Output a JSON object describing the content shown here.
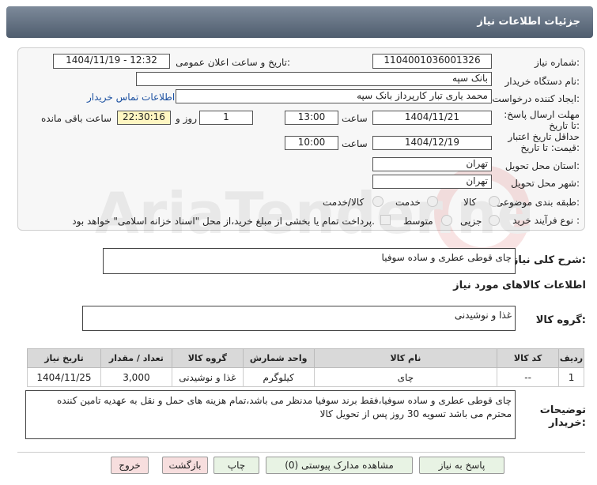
{
  "page_title": "جزئیات اطلاعات نیاز",
  "fields": {
    "need_number_label": "شماره نیاز:",
    "need_number": "1104001036001326",
    "announce_label": "تاریخ و ساعت اعلان عمومی:",
    "announce_value": "1404/11/19 - 12:32",
    "buyer_org_label": "نام دستگاه خریدار:",
    "buyer_org": "بانک سپه",
    "requester_label": "ایجاد کننده درخواست:",
    "requester": "محمد یاری تبار کارپرداز بانک سپه",
    "contact_link": "اطلاعات تماس خریدار",
    "deadline_label": "مهلت ارسال پاسخ: تا تاریخ:",
    "deadline_date": "1404/11/21",
    "time_label": "ساعت",
    "deadline_time": "13:00",
    "days_value": "1",
    "days_label": "روز و",
    "remaining_time": "22:30:16",
    "remaining_label": "ساعت باقی مانده",
    "validity_label": "حداقل تاریخ اعتبار قیمت: تا تاریخ:",
    "validity_date": "1404/12/19",
    "validity_time": "10:00",
    "province_label": "استان محل تحویل:",
    "province": "تهران",
    "city_label": "شهر محل تحویل:",
    "city": "تهران",
    "category_label": "طبقه بندی موضوعی:",
    "category_options": [
      "کالا",
      "خدمت",
      "کالا/خدمت"
    ],
    "process_label": "نوع فرآیند خرید :",
    "process_options": [
      "جزیی",
      "متوسط"
    ],
    "process_note": "پرداخت تمام یا بخشی از مبلغ خرید،از محل \"اسناد خزانه اسلامی\" خواهد بود."
  },
  "summary": {
    "label": "شرح کلی نیاز:",
    "value": "چای قوطی عطری و ساده سوفیا"
  },
  "goods_section_title": "اطلاعات کالاهای مورد نیاز",
  "goods_group": {
    "label": "گروه کالا:",
    "value": "غذا و نوشیدنی"
  },
  "table": {
    "headers": [
      "ردیف",
      "کد کالا",
      "نام کالا",
      "واحد شمارش",
      "گروه کالا",
      "تعداد / مقدار",
      "تاریخ نیاز"
    ],
    "rows": [
      [
        "1",
        "--",
        "چای",
        "کیلوگرم",
        "غذا و نوشیدنی",
        "3,000",
        "1404/11/25"
      ]
    ]
  },
  "buyer_notes": {
    "label": "توضیحات خریدار:",
    "value": "چای قوطی عطری و ساده سوفیا،فقط برند سوفیا مدنظر می باشد،تمام هزینه های حمل و نقل به عهدیه تامین کننده محترم می باشد تسویه 30 روز پس از تحویل کالا"
  },
  "buttons": {
    "reply": "پاسخ به نیاز",
    "view_docs": "مشاهده مدارک پیوستی (0)",
    "print": "چاپ",
    "back": "بازگشت",
    "exit": "خروج"
  },
  "watermark": "AriaTender.net",
  "colors": {
    "title_bar": "#5f6d7e",
    "link": "#1a4fa0",
    "highlight": "#fff6c2",
    "exit_button": "#f7dede",
    "button": "#e8f3e4"
  }
}
